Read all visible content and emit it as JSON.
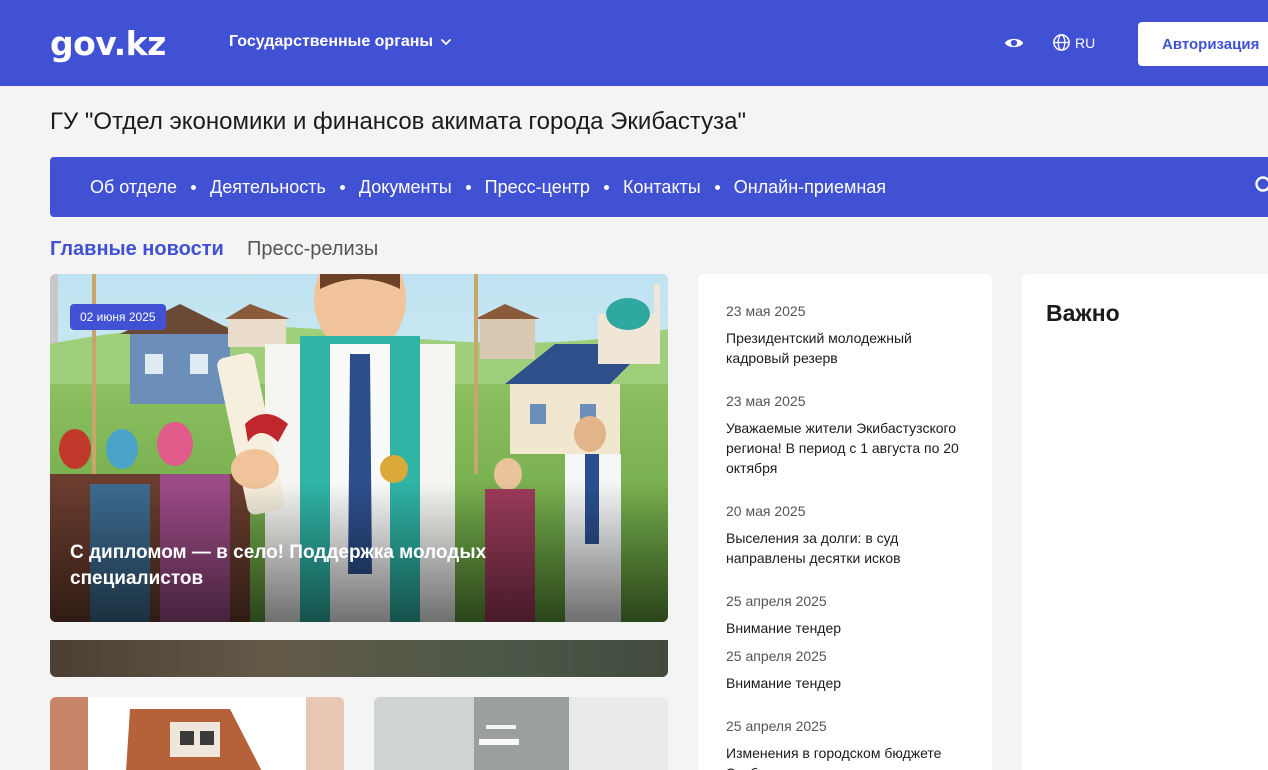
{
  "header": {
    "logo": "gov.kz",
    "gov_organs": "Государственные органы",
    "language": "RU",
    "auth_label": "Авторизация"
  },
  "org_title": "ГУ \"Отдел экономики и финансов акимата города Экибастуза\"",
  "nav": {
    "items": [
      "Об отделе",
      "Деятельность",
      "Документы",
      "Пресс-центр",
      "Контакты",
      "Онлайн-приемная"
    ]
  },
  "tabs": {
    "main_news": "Главные новости",
    "press_releases": "Пресс-релизы"
  },
  "featured": {
    "date": "02 июня 2025",
    "title": "С дипломом — в село! Поддержка молодых специалистов"
  },
  "news": [
    {
      "date": "23 мая 2025",
      "title": "Президентский молодежный кадровый резерв"
    },
    {
      "date": "23 мая 2025",
      "title": "Уважаемые жители Экибастузского региона! В период с 1 августа по 20 октября"
    },
    {
      "date": "20 мая 2025",
      "title": "Выселения за долги: в суд направлены десятки исков"
    },
    {
      "date": "25 апреля 2025",
      "title": "Внимание тендер"
    },
    {
      "date": "25 апреля 2025",
      "title": "Внимание тендер"
    },
    {
      "date": "25 апреля 2025",
      "title": "Изменения в городском бюджете Экибастуза"
    }
  ],
  "important": {
    "heading": "Важно"
  },
  "colors": {
    "brand": "#4051d4",
    "background": "#f4f4f4"
  }
}
